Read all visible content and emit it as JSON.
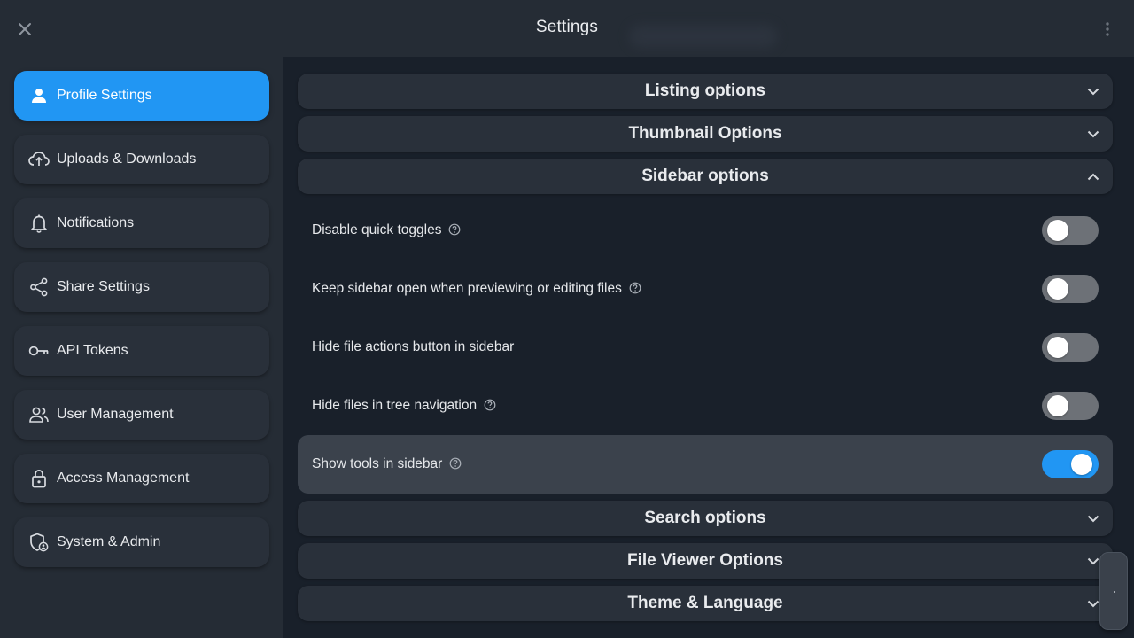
{
  "header": {
    "title": "Settings",
    "close_icon": "close-icon",
    "more_icon": "more-vertical-icon"
  },
  "colors": {
    "accent": "#2196f3",
    "panel": "#252c35",
    "card": "#29303a",
    "background": "#19202a"
  },
  "sidebar": {
    "items": [
      {
        "label": "Profile Settings",
        "icon": "person-icon",
        "active": true
      },
      {
        "label": "Uploads & Downloads",
        "icon": "cloud-sync-icon",
        "active": false
      },
      {
        "label": "Notifications",
        "icon": "bell-icon",
        "active": false
      },
      {
        "label": "Share Settings",
        "icon": "share-icon",
        "active": false
      },
      {
        "label": "API Tokens",
        "icon": "key-icon",
        "active": false
      },
      {
        "label": "User Management",
        "icon": "users-icon",
        "active": false
      },
      {
        "label": "Access Management",
        "icon": "lock-icon",
        "active": false
      },
      {
        "label": "System & Admin",
        "icon": "shield-admin-icon",
        "active": false
      }
    ]
  },
  "main": {
    "sections": [
      {
        "title": "Listing options",
        "expanded": false
      },
      {
        "title": "Thumbnail Options",
        "expanded": false
      },
      {
        "title": "Sidebar options",
        "expanded": true
      },
      {
        "title": "Search options",
        "expanded": false
      },
      {
        "title": "File Viewer Options",
        "expanded": false
      },
      {
        "title": "Theme & Language",
        "expanded": false
      }
    ],
    "sidebar_options": [
      {
        "label": "Disable quick toggles",
        "help": true,
        "enabled": false
      },
      {
        "label": "Keep sidebar open when previewing or editing files",
        "help": true,
        "enabled": false
      },
      {
        "label": "Hide file actions button in sidebar",
        "help": false,
        "enabled": false
      },
      {
        "label": "Hide files in tree navigation",
        "help": true,
        "enabled": false
      },
      {
        "label": "Show tools in sidebar",
        "help": true,
        "enabled": true
      }
    ]
  }
}
